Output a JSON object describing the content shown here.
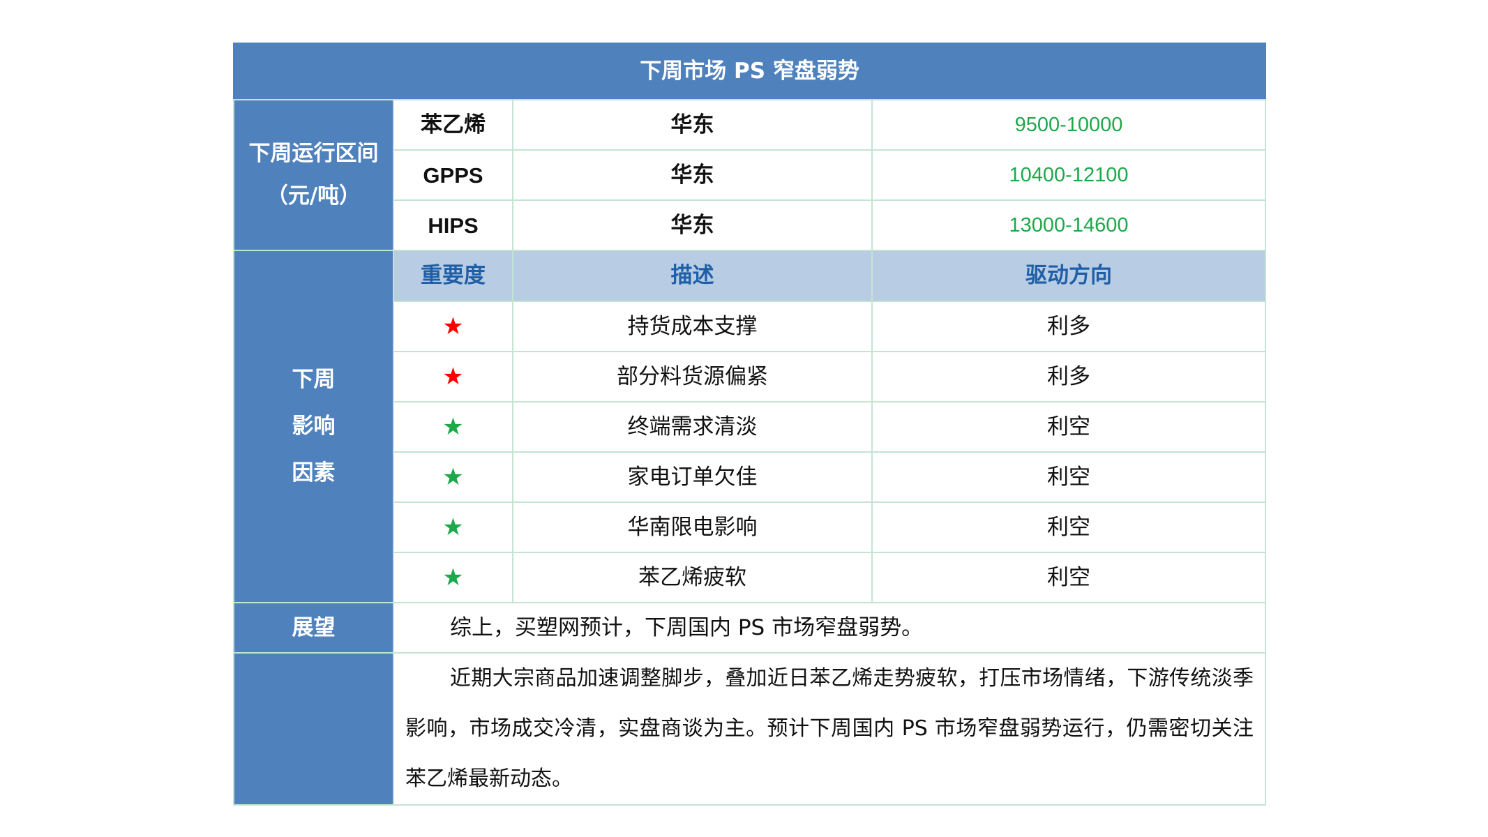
{
  "title": "下周市场 PS 窄盘弱势",
  "price_range": {
    "label_line1": "下周运行区间",
    "label_line2": "（元/吨）",
    "rows": [
      {
        "product": "苯乙烯",
        "region": "华东",
        "range": "9500-10000"
      },
      {
        "product": "GPPS",
        "region": "华东",
        "range": "10400-12100"
      },
      {
        "product": "HIPS",
        "region": "华东",
        "range": "13000-14600"
      }
    ]
  },
  "factors": {
    "label_lines": [
      "下周",
      "影响",
      "因素"
    ],
    "headers": {
      "importance": "重要度",
      "description": "描述",
      "direction": "驱动方向"
    },
    "rows": [
      {
        "star": "★",
        "star_color": "#ff0000",
        "description": "持货成本支撑",
        "direction": "利多"
      },
      {
        "star": "★",
        "star_color": "#ff0000",
        "description": "部分料货源偏紧",
        "direction": "利多"
      },
      {
        "star": "★",
        "star_color": "#1ea84a",
        "description": "终端需求清淡",
        "direction": "利空"
      },
      {
        "star": "★",
        "star_color": "#1ea84a",
        "description": "家电订单欠佳",
        "direction": "利空"
      },
      {
        "star": "★",
        "star_color": "#1ea84a",
        "description": "华南限电影响",
        "direction": "利空"
      },
      {
        "star": "★",
        "star_color": "#1ea84a",
        "description": "苯乙烯疲软",
        "direction": "利空"
      }
    ]
  },
  "outlook": {
    "label": "展望",
    "text": "综上，买塑网预计，下周国内 PS 市场窄盘弱势。"
  },
  "analysis": {
    "text": "近期大宗商品加速调整脚步，叠加近日苯乙烯走势疲软，打压市场情绪，下游传统淡季影响，市场成交冷清，实盘商谈为主。预计下周国内 PS 市场窄盘弱势运行，仍需密切关注苯乙烯最新动态。"
  },
  "colors": {
    "header_blue": "#4f81bd",
    "subheader_blue": "#b8cce4",
    "value_green": "#1ea84a",
    "star_red": "#ff0000",
    "star_green": "#1ea84a"
  }
}
